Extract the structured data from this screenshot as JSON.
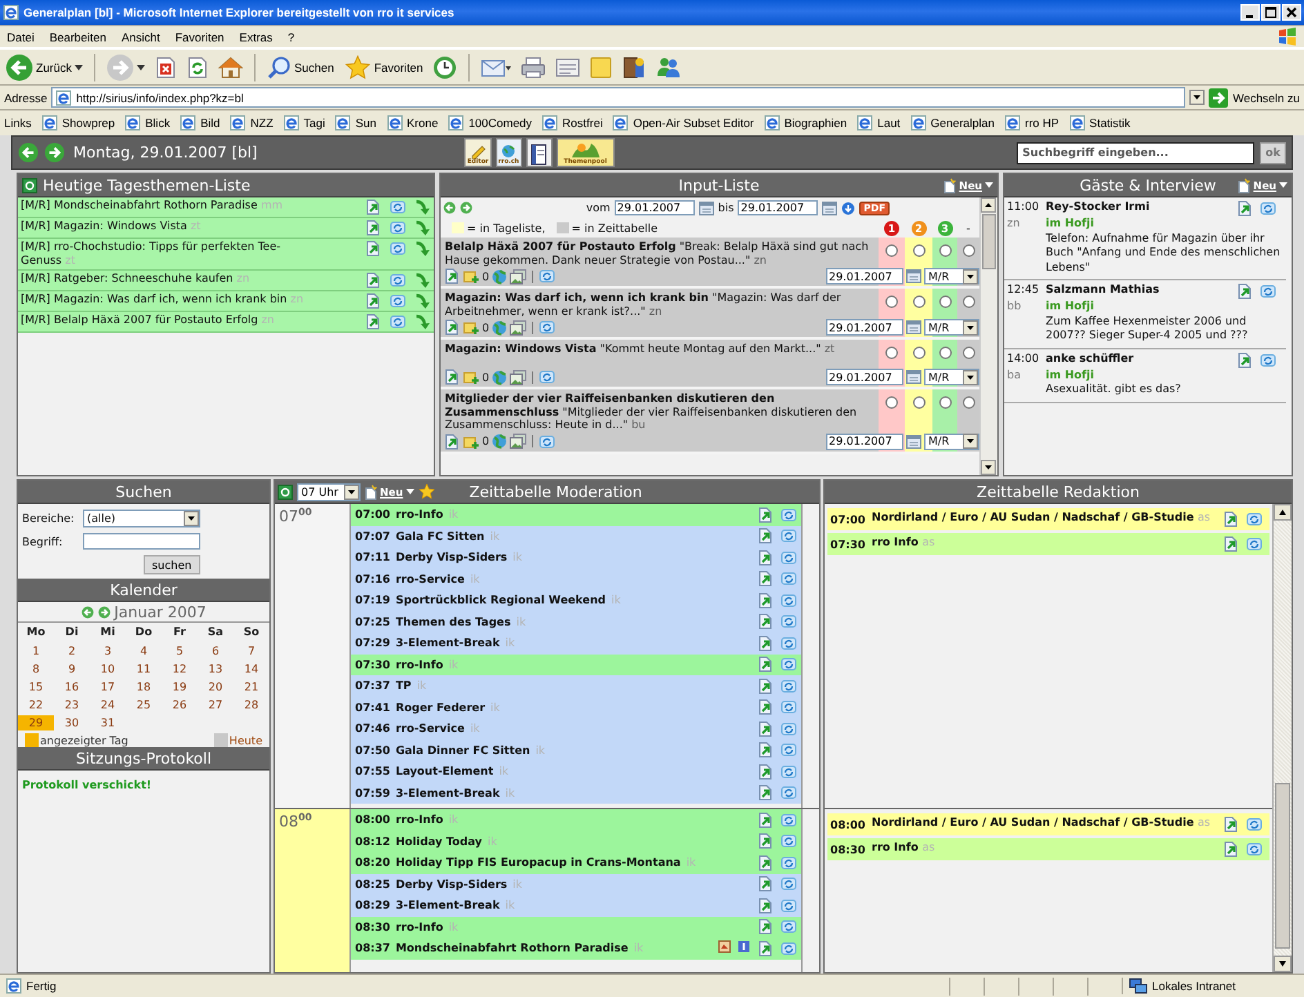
{
  "window": {
    "title": "Generalplan [bl] - Microsoft Internet Explorer bereitgestellt von rro it services"
  },
  "menu": [
    "Datei",
    "Bearbeiten",
    "Ansicht",
    "Favoriten",
    "Extras",
    "?"
  ],
  "toolbar": [
    {
      "kind": "back",
      "label": "Zurück"
    },
    {
      "kind": "forward"
    },
    {
      "kind": "stop"
    },
    {
      "kind": "refresh"
    },
    {
      "kind": "home"
    },
    {
      "kind": "search",
      "label": "Suchen"
    },
    {
      "kind": "favorites",
      "label": "Favoriten"
    },
    {
      "kind": "history"
    },
    {
      "kind": "mail"
    },
    {
      "kind": "print"
    },
    {
      "kind": "edit"
    },
    {
      "kind": "note"
    },
    {
      "kind": "research"
    },
    {
      "kind": "messenger"
    }
  ],
  "address": {
    "label": "Adresse",
    "value": "http://sirius/info/index.php?kz=bl",
    "go": "Wechseln zu"
  },
  "links": {
    "label": "Links",
    "items": [
      "Showprep",
      "Blick",
      "Bild",
      "NZZ",
      "Tagi",
      "Sun",
      "Krone",
      "100Comedy",
      "Rostfrei",
      "Open-Air Subset Editor",
      "Biographien",
      "Laut",
      "Generalplan",
      "rro HP",
      "Statistik"
    ]
  },
  "app_header": {
    "date": "Montag, 29.01.2007 [bl]",
    "search": {
      "placeholder": "Suchbegriff eingeben..."
    },
    "search_button": "ok",
    "tools": [
      {
        "kind": "editor",
        "label": "Editor"
      },
      {
        "kind": "web",
        "label": "rro.ch"
      },
      {
        "kind": "book"
      },
      {
        "kind": "pool",
        "label": "Themenpool"
      }
    ]
  },
  "topics": {
    "title": "Heutige Tagesthemen-Liste",
    "items": [
      {
        "text": "[M/R] Mondscheinabfahrt Rothorn Paradise",
        "author": "mm"
      },
      {
        "text": "[M/R] Magazin: Windows Vista",
        "author": "zt"
      },
      {
        "text": "[M/R] rro-Chochstudio: Tipps für perfekten Tee-Genuss",
        "author": "zt"
      },
      {
        "text": "[M/R] Ratgeber: Schneeschuhe kaufen",
        "author": "zn"
      },
      {
        "text": "[M/R] Magazin: Was darf ich, wenn ich krank bin",
        "author": "zn"
      },
      {
        "text": "[M/R] Belalp Häxä 2007 für Postauto Erfolg",
        "author": "zn"
      }
    ]
  },
  "input_list": {
    "title": "Input-Liste",
    "new": "Neu",
    "from_label": "vom",
    "from": "29.01.2007",
    "to_label": "bis",
    "to": "29.01.2007",
    "pdf": "PDF",
    "legend": [
      {
        "kind": "daily",
        "text": "= in Tageliste,"
      },
      {
        "kind": "timetable",
        "text": "= in Zeittabelle"
      }
    ],
    "priorities": [
      {
        "label": "1",
        "color": "#d81818"
      },
      {
        "label": "2",
        "color": "#f0901c"
      },
      {
        "label": "3",
        "color": "#3cb43c"
      },
      {
        "label": "-"
      }
    ],
    "items": [
      {
        "title": "Belalp Häxä 2007 für Postauto Erfolg",
        "excerpt": "\"Break: Belalp Häxä sind gut nach Hause gekommen. Dank neuer Strategie von Postau...\"",
        "author": "zn",
        "in_timetable": true,
        "count": "0",
        "date": "29.01.2007",
        "channel": "M/R",
        "radios": [
          {
            "selected": false
          },
          {
            "selected": false
          },
          {
            "selected": false
          },
          {
            "selected": false
          }
        ]
      },
      {
        "title": "Magazin: Was darf ich, wenn ich krank bin",
        "excerpt": "\"Magazin: Was darf der Arbeitnehmer, wenn er krank ist?...\"",
        "author": "zn",
        "in_timetable": true,
        "count": "0",
        "date": "29.01.2007",
        "channel": "M/R",
        "radios": [
          {
            "selected": false
          },
          {
            "selected": false
          },
          {
            "selected": false
          },
          {
            "selected": false
          }
        ]
      },
      {
        "title": "Magazin: Windows Vista",
        "excerpt": "\"Kommt heute Montag auf den Markt...\"",
        "author": "zt",
        "in_timetable": true,
        "count": "0",
        "date": "29.01.2007",
        "channel": "M/R",
        "radios": [
          {
            "selected": false
          },
          {
            "selected": false
          },
          {
            "selected": false
          },
          {
            "selected": false
          }
        ]
      },
      {
        "title": "Mitglieder der vier Raiffeisenbanken diskutieren den Zusammenschluss",
        "excerpt": "\"Mitglieder der vier Raiffeisenbanken diskutieren den Zusammenschluss: Heute in d...\"",
        "author": "bu",
        "in_timetable": true,
        "count": "0",
        "date": "29.01.2007",
        "channel": "M/R",
        "radios": [
          {
            "selected": false
          },
          {
            "selected": false
          },
          {
            "selected": false
          },
          {
            "selected": false
          }
        ]
      }
    ]
  },
  "guests": {
    "title": "Gäste & Interview",
    "new": "Neu",
    "items": [
      {
        "time": "11:00",
        "name": "Rey-Stocker Irmi",
        "author": "zn",
        "place": "im Hofji",
        "note": "Telefon: Aufnahme für Magazin über ihr Buch \"Anfang und Ende des menschlichen Lebens\""
      },
      {
        "time": "12:45",
        "name": "Salzmann Mathias",
        "author": "bb",
        "place": "im Hofji",
        "note": "Zum Kaffee Hexenmeister 2006 und 2007?? Sieger Super-4 2005 und ???"
      },
      {
        "time": "14:00",
        "name": "anke schüffler",
        "author": "ba",
        "place": "im Hofji",
        "note": "Asexualität. gibt es das?"
      }
    ]
  },
  "search": {
    "title": "Suchen",
    "area_label": "Bereiche:",
    "area": "(alle)",
    "term_label": "Begriff:",
    "button": "suchen"
  },
  "calendar": {
    "title": "Kalender",
    "month": "Januar 2007",
    "weekdays": [
      "Mo",
      "Di",
      "Mi",
      "Do",
      "Fr",
      "Sa",
      "So"
    ],
    "days": [
      {
        "label": "1",
        "selected": false
      },
      {
        "label": "2",
        "selected": false
      },
      {
        "label": "3",
        "selected": false
      },
      {
        "label": "4",
        "selected": false
      },
      {
        "label": "5",
        "selected": false
      },
      {
        "label": "6",
        "selected": false
      },
      {
        "label": "7",
        "selected": false
      },
      {
        "label": "8",
        "selected": false
      },
      {
        "label": "9",
        "selected": false
      },
      {
        "label": "10",
        "selected": false
      },
      {
        "label": "11",
        "selected": false
      },
      {
        "label": "12",
        "selected": false
      },
      {
        "label": "13",
        "selected": false
      },
      {
        "label": "14",
        "selected": false
      },
      {
        "label": "15",
        "selected": false
      },
      {
        "label": "16",
        "selected": false
      },
      {
        "label": "17",
        "selected": false
      },
      {
        "label": "18",
        "selected": false
      },
      {
        "label": "19",
        "selected": false
      },
      {
        "label": "20",
        "selected": false
      },
      {
        "label": "21",
        "selected": false
      },
      {
        "label": "22",
        "selected": false
      },
      {
        "label": "23",
        "selected": false
      },
      {
        "label": "24",
        "selected": false
      },
      {
        "label": "25",
        "selected": false
      },
      {
        "label": "26",
        "selected": false
      },
      {
        "label": "27",
        "selected": false
      },
      {
        "label": "28",
        "selected": false
      },
      {
        "label": "29",
        "selected": true
      },
      {
        "label": "30",
        "selected": false
      },
      {
        "label": "31",
        "selected": false
      }
    ],
    "legend": [
      {
        "kind": "shown",
        "label": "angezeigter Tag"
      },
      {
        "kind": "today",
        "label": "Heute"
      }
    ]
  },
  "protocol": {
    "title": "Sitzungs-Protokoll",
    "message": "Protokoll verschickt!"
  },
  "moderation": {
    "title": "Zeittabelle Moderation",
    "hour_select": "07 Uhr",
    "new": "Neu",
    "hours": [
      {
        "label": "07$^{00}$",
        "current": false,
        "rows": [
          {
            "time": "07:00",
            "title": "rro-Info",
            "author": "ik",
            "color": "#9cf59c",
            "extras": false
          },
          {
            "time": "07:07",
            "title": "Gala FC Sitten",
            "author": "ik",
            "color": "#c2d8f8",
            "extras": false
          },
          {
            "time": "07:11",
            "title": "Derby Visp-Siders",
            "author": "ik",
            "color": "#c2d8f8",
            "extras": false
          },
          {
            "time": "07:16",
            "title": "rro-Service",
            "author": "ik",
            "color": "#c2d8f8",
            "extras": false
          },
          {
            "time": "07:19",
            "title": "Sportrückblick Regional Weekend",
            "author": "ik",
            "color": "#c2d8f8",
            "extras": false
          },
          {
            "time": "07:25",
            "title": "Themen des Tages",
            "author": "ik",
            "color": "#c2d8f8",
            "extras": false
          },
          {
            "time": "07:29",
            "title": "3-Element-Break",
            "author": "ik",
            "color": "#c2d8f8",
            "extras": false
          },
          {
            "time": "07:30",
            "title": "rro-Info",
            "author": "ik",
            "color": "#9cf59c",
            "extras": false
          },
          {
            "time": "07:37",
            "title": "TP",
            "author": "ik",
            "color": "#c2d8f8",
            "extras": false
          },
          {
            "time": "07:41",
            "title": "Roger Federer",
            "author": "ik",
            "color": "#c2d8f8",
            "extras": false
          },
          {
            "time": "07:46",
            "title": "rro-Service",
            "author": "ik",
            "color": "#c2d8f8",
            "extras": false
          },
          {
            "time": "07:50",
            "title": "Gala Dinner FC Sitten",
            "author": "ik",
            "color": "#c2d8f8",
            "extras": false
          },
          {
            "time": "07:55",
            "title": "Layout-Element",
            "author": "ik",
            "color": "#c2d8f8",
            "extras": false
          },
          {
            "time": "07:59",
            "title": "3-Element-Break",
            "author": "ik",
            "color": "#c2d8f8",
            "extras": false
          }
        ]
      },
      {
        "label": "08$^{00}$",
        "current": true,
        "rows": [
          {
            "time": "08:00",
            "title": "rro-Info",
            "author": "ik",
            "color": "#9cf59c",
            "extras": false
          },
          {
            "time": "08:12",
            "title": "Holiday Today",
            "author": "ik",
            "color": "#9cf59c",
            "extras": false
          },
          {
            "time": "08:20",
            "title": "Holiday Tipp FIS Europacup in Crans-Montana",
            "author": "ik",
            "color": "#9cf59c",
            "extras": false
          },
          {
            "time": "08:25",
            "title": "Derby Visp-Siders",
            "author": "ik",
            "color": "#c2d8f8",
            "extras": false
          },
          {
            "time": "08:29",
            "title": "3-Element-Break",
            "author": "ik",
            "color": "#c2d8f8",
            "extras": false
          },
          {
            "time": "08:30",
            "title": "rro-Info",
            "author": "ik",
            "color": "#9cf59c",
            "extras": false
          },
          {
            "time": "08:37",
            "title": "Mondscheinabfahrt Rothorn Paradise",
            "author": "ik",
            "color": "#9cf59c",
            "extras": true
          }
        ]
      }
    ]
  },
  "editorial": {
    "title": "Zeittabelle Redaktion",
    "hours": [
      {
        "rows": [
          {
            "time": "07:00",
            "title": "Nordirland / Euro / AU Sudan / Nadschaf / GB-Studie",
            "author": "as",
            "color": "#ffff99"
          },
          {
            "time": "07:30",
            "title": "rro Info",
            "author": "as",
            "color": "#ccff99"
          }
        ]
      },
      {
        "rows": [
          {
            "time": "08:00",
            "title": "Nordirland / Euro / AU Sudan / Nadschaf / GB-Studie",
            "author": "as",
            "color": "#ffff99"
          },
          {
            "time": "08:30",
            "title": "rro Info",
            "author": "as",
            "color": "#ccff99"
          }
        ]
      }
    ]
  },
  "status_bar": {
    "text": "Fertig",
    "zone": "Lokales Intranet"
  }
}
